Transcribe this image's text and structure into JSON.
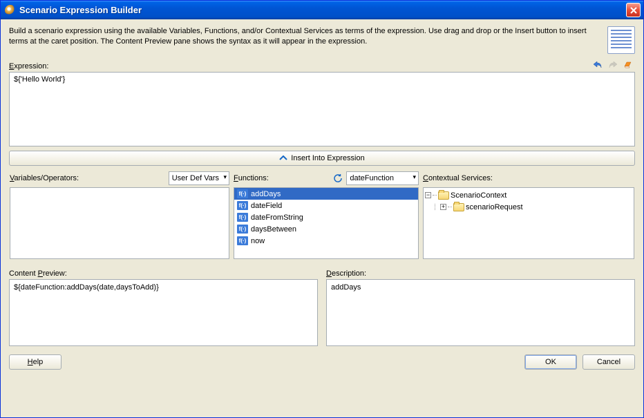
{
  "title": "Scenario Expression Builder",
  "instructions": "Build a scenario expression using the available Variables, Functions, and/or Contextual Services as terms of the expression. Use drag and drop or the Insert button to insert terms at the caret position. The Content Preview pane shows the syntax as it will appear in the expression.",
  "expression": {
    "label": "Expression:",
    "label_underline": "E",
    "value": "${'Hello World'}"
  },
  "insert_button": "Insert Into Expression",
  "variables": {
    "label": "Variables/Operators:",
    "label_underline": "V",
    "dropdown": "User Def Vars"
  },
  "functions": {
    "label": "Functions:",
    "label_underline": "F",
    "dropdown": "dateFunction",
    "items": [
      "addDays",
      "dateField",
      "dateFromString",
      "daysBetween",
      "now"
    ],
    "selected_index": 0
  },
  "contextual": {
    "label": "Contextual Services:",
    "label_underline": "C",
    "root": "ScenarioContext",
    "child": "scenarioRequest"
  },
  "preview": {
    "label": "Content Preview:",
    "label_underline": "P",
    "value": "${dateFunction:addDays(date,daysToAdd)}"
  },
  "description": {
    "label": "Description:",
    "label_underline": "D",
    "value": "addDays"
  },
  "buttons": {
    "help": "Help",
    "ok": "OK",
    "cancel": "Cancel"
  }
}
